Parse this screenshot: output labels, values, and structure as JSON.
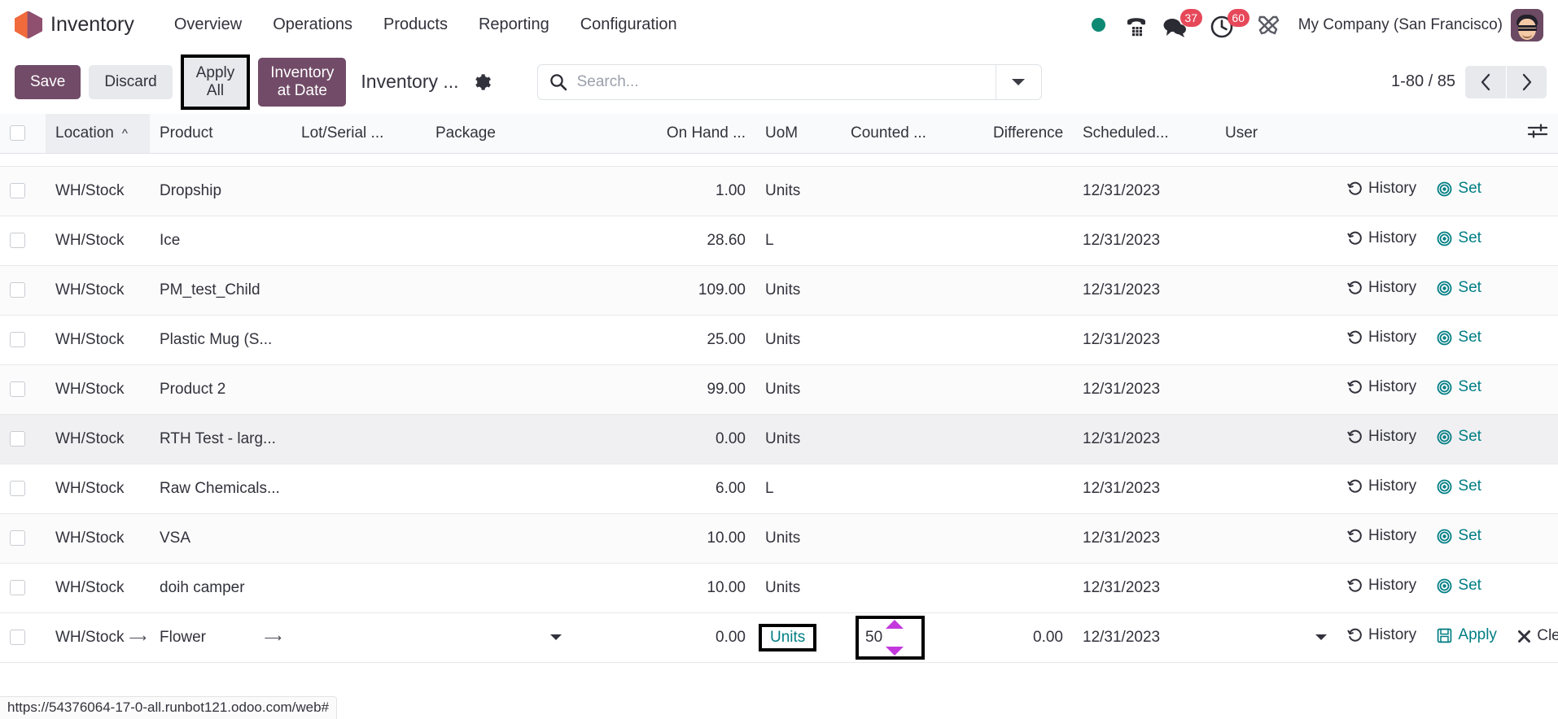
{
  "navbar": {
    "brand": "Inventory",
    "menu": [
      {
        "label": "Overview"
      },
      {
        "label": "Operations"
      },
      {
        "label": "Products"
      },
      {
        "label": "Reporting"
      },
      {
        "label": "Configuration"
      }
    ],
    "systray": {
      "presence_icon": "presence-dot-icon",
      "phone_icon": "phone-dialpad-icon",
      "messages_icon": "chat-bubbles-icon",
      "messages_count": "37",
      "activities_icon": "clock-icon",
      "activities_count": "60",
      "tools_icon": "tools-icon",
      "company": "My Company (San Francisco)",
      "avatar_icon": "user-avatar-icon"
    }
  },
  "control_panel": {
    "save_label": "Save",
    "discard_label": "Discard",
    "apply_all_label_line1": "Apply",
    "apply_all_label_line2": "All",
    "inventory_at_date_line1": "Inventory",
    "inventory_at_date_line2": "at Date",
    "breadcrumb": "Inventory ...",
    "gear_icon": "gear-icon",
    "search": {
      "icon": "search-icon",
      "placeholder": "Search...",
      "value": "",
      "toggle_icon": "chevron-down-icon"
    },
    "pager": {
      "count": "1-80 / 85",
      "prev_icon": "chevron-left-icon",
      "next_icon": "chevron-right-icon"
    }
  },
  "table": {
    "optional_columns_icon": "sliders-icon",
    "sort_indicator": "caret-up-icon",
    "columns": [
      {
        "label": "Location",
        "sorted": true
      },
      {
        "label": "Product"
      },
      {
        "label": "Lot/Serial ..."
      },
      {
        "label": "Package"
      },
      {
        "label": "On Hand ..."
      },
      {
        "label": "UoM"
      },
      {
        "label": "Counted ..."
      },
      {
        "label": "Difference"
      },
      {
        "label": "Scheduled..."
      },
      {
        "label": "User"
      }
    ],
    "actions": {
      "history_label": "History",
      "history_icon": "history-icon",
      "set_label": "Set",
      "set_icon": "target-icon",
      "apply_label": "Apply",
      "apply_icon": "save-floppy-icon",
      "clear_label": "Clear",
      "clear_icon": "close-x-icon"
    },
    "rows": [
      {
        "location": "WH/Stock",
        "product": "Dropship",
        "lot": "",
        "package": "",
        "on_hand": "1.00",
        "uom": "Units",
        "counted": "",
        "difference": "",
        "scheduled": "12/31/2023",
        "user": ""
      },
      {
        "location": "WH/Stock",
        "product": "Ice",
        "lot": "",
        "package": "",
        "on_hand": "28.60",
        "uom": "L",
        "counted": "",
        "difference": "",
        "scheduled": "12/31/2023",
        "user": ""
      },
      {
        "location": "WH/Stock",
        "product": "PM_test_Child",
        "lot": "",
        "package": "",
        "on_hand": "109.00",
        "uom": "Units",
        "counted": "",
        "difference": "",
        "scheduled": "12/31/2023",
        "user": ""
      },
      {
        "location": "WH/Stock",
        "product": "Plastic Mug (S...",
        "lot": "",
        "package": "",
        "on_hand": "25.00",
        "uom": "Units",
        "counted": "",
        "difference": "",
        "scheduled": "12/31/2023",
        "user": ""
      },
      {
        "location": "WH/Stock",
        "product": "Product 2",
        "lot": "",
        "package": "",
        "on_hand": "99.00",
        "uom": "Units",
        "counted": "",
        "difference": "",
        "scheduled": "12/31/2023",
        "user": ""
      },
      {
        "location": "WH/Stock",
        "product": "RTH Test - larg...",
        "lot": "",
        "package": "",
        "on_hand": "0.00",
        "uom": "Units",
        "counted": "",
        "difference": "",
        "scheduled": "12/31/2023",
        "user": ""
      },
      {
        "location": "WH/Stock",
        "product": "Raw Chemicals...",
        "lot": "",
        "package": "",
        "on_hand": "6.00",
        "uom": "L",
        "counted": "",
        "difference": "",
        "scheduled": "12/31/2023",
        "user": ""
      },
      {
        "location": "WH/Stock",
        "product": "VSA",
        "lot": "",
        "package": "",
        "on_hand": "10.00",
        "uom": "Units",
        "counted": "",
        "difference": "",
        "scheduled": "12/31/2023",
        "user": ""
      },
      {
        "location": "WH/Stock",
        "product": "doih camper",
        "lot": "",
        "package": "",
        "on_hand": "10.00",
        "uom": "Units",
        "counted": "",
        "difference": "",
        "scheduled": "12/31/2023",
        "user": ""
      }
    ],
    "editing_row": {
      "location": "WH/Stock",
      "product": "Flower",
      "lot": "",
      "package": "",
      "on_hand": "0.00",
      "uom": "Units",
      "counted": "50",
      "difference": "0.00",
      "scheduled": "12/31/2023",
      "user": ""
    }
  },
  "statusbar": {
    "url": "https://54376064-17-0-all.runbot121.odoo.com/web#"
  },
  "colors": {
    "brand_purple": "#714b67",
    "teal_link": "#017e84",
    "badge_red": "#e6485a",
    "presence_green": "#0e8a74",
    "spinner_magenta": "#c238dd",
    "selection_black": "#000000"
  }
}
